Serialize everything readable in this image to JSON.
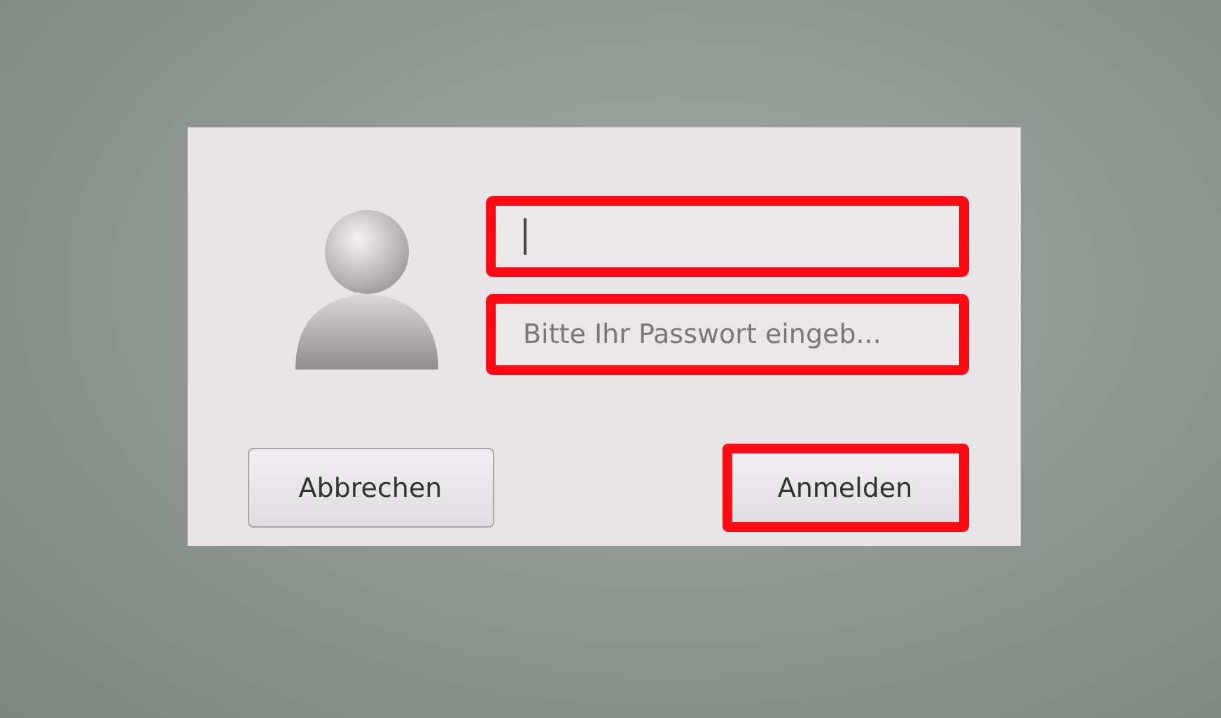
{
  "login_dialog": {
    "username_field": {
      "focused": true,
      "highlighted": true
    },
    "password_field": {
      "placeholder": "Bitte Ihr Passwort eingeb...",
      "highlighted": true
    },
    "buttons": [
      {
        "label": "Abbrechen",
        "highlighted": false
      },
      {
        "label": "Anmelden",
        "highlighted": true
      }
    ]
  }
}
